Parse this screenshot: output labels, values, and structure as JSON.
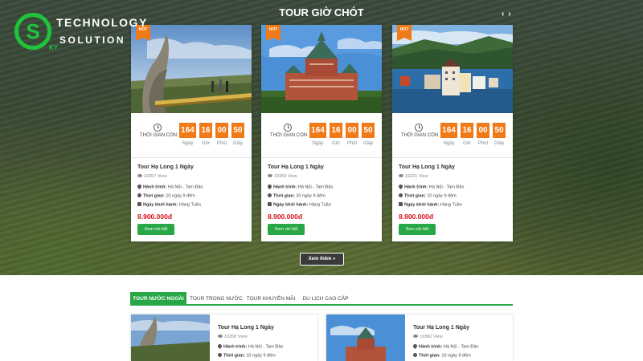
{
  "logo": {
    "line1": "TECHNOLOGY",
    "line2": "SOLUTION",
    "mark": "S",
    "mark_small": "KY",
    "color": "#1fc43b"
  },
  "hero": {
    "title": "TOUR GIỜ CHÓT",
    "prev_arrow": "‹",
    "next_arrow": "›"
  },
  "colors": {
    "accent_green": "#27a745",
    "countdown_orange": "#f07a18",
    "price_red": "#d8101a"
  },
  "tours": [
    {
      "hot": "HOT",
      "countdown": {
        "label": "THỜI GIAN CÒN",
        "days": "164",
        "hours": "16",
        "minutes": "00",
        "seconds": "50",
        "days_unit": "Ngày",
        "hours_unit": "Giờ",
        "minutes_unit": "Phút",
        "seconds_unit": "Giây"
      },
      "name": "Tour Hạ Long 1 Ngày",
      "views": "19357 View",
      "route_label": "Hành trình:",
      "route": "Hà Nội - Tam Đảo",
      "time_label": "Thời gian:",
      "time": "10 ngày 9 đêm",
      "depart_label": "Ngày khởi hành:",
      "depart": "Hàng Tuần",
      "price": "8.900.000đ",
      "button": "Xem chi tiết",
      "image": "golden-bridge-photo"
    },
    {
      "hot": "HOT",
      "countdown": {
        "label": "THỜI GIAN CÒN",
        "days": "164",
        "hours": "16",
        "minutes": "00",
        "seconds": "50",
        "days_unit": "Ngày",
        "hours_unit": "Giờ",
        "minutes_unit": "Phút",
        "seconds_unit": "Giây"
      },
      "name": "Tour Hạ Long 1 Ngày",
      "views": "19359 View",
      "route_label": "Hành trình:",
      "route": "Hà Nội - Tam Đảo",
      "time_label": "Thời gian:",
      "time": "10 ngày 9 đêm",
      "depart_label": "Ngày khởi hành:",
      "depart": "Hàng Tuần",
      "price": "8.900.000đ",
      "button": "Xem chi tiết",
      "image": "chateau-photo"
    },
    {
      "hot": "HOT",
      "countdown": {
        "label": "THỜI GIAN CÒN",
        "days": "164",
        "hours": "16",
        "minutes": "00",
        "seconds": "50",
        "days_unit": "Ngày",
        "hours_unit": "Giờ",
        "minutes_unit": "Phút",
        "seconds_unit": "Giây"
      },
      "name": "Tour Hạ Long 1 Ngày",
      "views": "19221 View",
      "route_label": "Hành trình:",
      "route": "Hà Nội - Tam Đảo",
      "time_label": "Thời gian:",
      "time": "10 ngày 9 đêm",
      "depart_label": "Ngày khởi hành:",
      "depart": "Hàng Tuần",
      "price": "8.900.000đ",
      "button": "Xem chi tiết",
      "image": "fjord-town-photo"
    }
  ],
  "more_button": "Xem thêm »",
  "tabs": [
    {
      "label": "TOUR NƯỚC NGOÀI",
      "active": true
    },
    {
      "label": "TOUR TRONG NƯỚC",
      "active": false
    },
    {
      "label": "TOUR KHUYẾN MÃI",
      "active": false
    },
    {
      "label": "DU LỊCH CAO CẤP",
      "active": false
    }
  ],
  "list": [
    {
      "name": "Tour Hạ Long 1 Ngày",
      "views": "19358 View",
      "route_label": "Hành trình:",
      "route": "Hà Nội - Tam Đảo",
      "time_label": "Thời gian:",
      "time": "10 ngày 9 đêm",
      "image": "golden-bridge-photo"
    },
    {
      "name": "Tour Hạ Long 1 Ngày",
      "views": "19360 View",
      "route_label": "Hành trình:",
      "route": "Hà Nội - Tam Đảo",
      "time_label": "Thời gian:",
      "time": "10 ngày 9 đêm",
      "image": "chateau-photo"
    }
  ]
}
